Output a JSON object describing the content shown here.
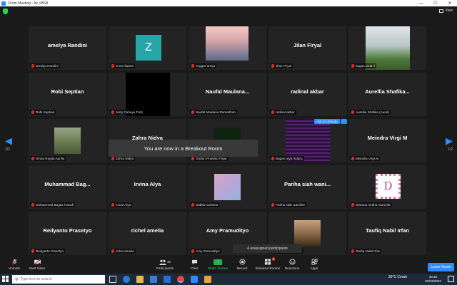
{
  "window": {
    "title": "Zoom Meeting - Ak VBS8",
    "minimize": "—",
    "maximize": "☐",
    "close": "✕"
  },
  "topbar": {
    "view_label": "View"
  },
  "participants": [
    {
      "name": "amelya Randini",
      "label": "amelya Randini",
      "type": "name"
    },
    {
      "name": "",
      "label": "zoom lia604",
      "type": "avatar",
      "avatar_letter": "Z",
      "avatar_color": "#26a6a8"
    },
    {
      "name": "",
      "label": "enggar arrtya",
      "type": "photo-girl"
    },
    {
      "name": "Jilan Firyal",
      "label": "Jilan Firyal",
      "type": "name"
    },
    {
      "name": "",
      "label": "bagas aisah f",
      "type": "photo-field"
    },
    {
      "name": "Robi Septian",
      "label": "Robi Septian",
      "type": "name"
    },
    {
      "name": "",
      "label": "Jerry Cahaya Putri",
      "type": "photo-black"
    },
    {
      "name": "Naufal  Maulana...",
      "label": "Naufal Maulana Ramadhan",
      "type": "name"
    },
    {
      "name": "radinal akbar",
      "label": "radinal akbar",
      "type": "name"
    },
    {
      "name": "Aurellia  Shafika...",
      "label": "Aurellia Shafika (Aurel)",
      "type": "name"
    },
    {
      "name": "",
      "label": "Dinda Regita Aprilia",
      "type": "photo-tree"
    },
    {
      "name": "Zahra Nidya",
      "label": "Zahra Nidya",
      "type": "name"
    },
    {
      "name": "",
      "label": "Taufan Prasetio Fajar",
      "type": "photo-darkgreen"
    },
    {
      "name": "",
      "label": "Bagas arya Indaru",
      "type": "photo-code"
    },
    {
      "name": "Meindra Virgi M",
      "label": "Meindra Virgi M",
      "type": "name"
    },
    {
      "name": "Muhammad  Bag...",
      "label": "Muhammad Bagas Hanafi",
      "type": "name"
    },
    {
      "name": "Irvina Alya",
      "label": "Irvina Alya",
      "type": "name"
    },
    {
      "name": "",
      "label": "Nabila Karisma",
      "type": "photo-pastel"
    },
    {
      "name": "Pariha  siah wani...",
      "label": "Pariha siah wanirike",
      "type": "name"
    },
    {
      "name": "",
      "label": "Dheana Vedha Nursyifa",
      "type": "photo-letterd",
      "avatar_letter": "D"
    },
    {
      "name": "Redyanto Prasetyo",
      "label": "Redyanto Prasetyo",
      "type": "name"
    },
    {
      "name": "richel amelia",
      "label": "richel amelia",
      "type": "name"
    },
    {
      "name": "Amy Pramudityo",
      "label": "Amy Pramudityo",
      "type": "name"
    },
    {
      "name": "",
      "label": "Aida Nuraini Dewi",
      "type": "photo-selfie"
    },
    {
      "name": "Taufiq Nabil Irfan",
      "label": "Taufiq Nabil Irfan",
      "type": "name"
    }
  ],
  "paging": {
    "left_page": "1/2",
    "right_page": "1/2"
  },
  "overlay": {
    "breakout_message": "You are now in a Breakout Room",
    "ask_to_unmute": "Ask to Unmute",
    "more": "···",
    "unassigned": "4 unassigned participants"
  },
  "toolbar": {
    "unmute": "Unmute",
    "start_video": "Start Video",
    "participants": "Participants",
    "participants_count": "36",
    "chat": "Chat",
    "share_screen": "Share Screen",
    "record": "Record",
    "breakout_rooms": "Breakout Rooms",
    "breakout_badge": "4",
    "reactions": "Reactions",
    "apps": "Apps",
    "leave_room": "Leave Room"
  },
  "taskbar": {
    "search_placeholder": "Type here to search",
    "weather": "30°C  Cerah",
    "time": "18:43",
    "date": "22/03/2022"
  },
  "colors": {
    "accent": "#2d8cff",
    "muted_red": "#e02828",
    "share_green": "#23b04b",
    "security_green": "#23d959"
  }
}
